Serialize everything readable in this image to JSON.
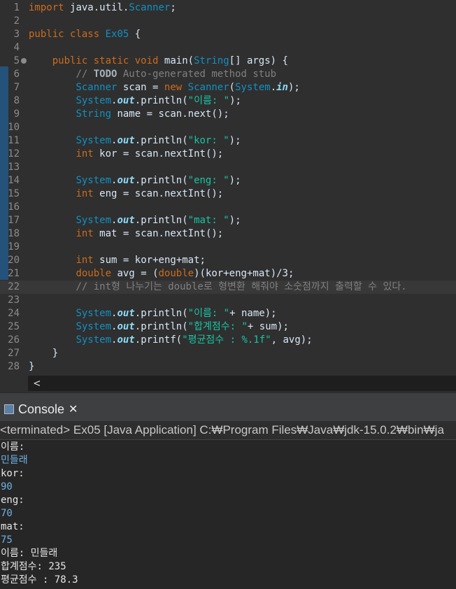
{
  "editor": {
    "lines": [
      {
        "n": "1",
        "code": "import java.util.Scanner;"
      },
      {
        "n": "2",
        "code": ""
      },
      {
        "n": "3",
        "code": "public class Ex05 {"
      },
      {
        "n": "4",
        "code": ""
      },
      {
        "n": "5",
        "code": "    public static void main(String[] args) {"
      },
      {
        "n": "6",
        "code": "        // TODO Auto-generated method stub"
      },
      {
        "n": "7",
        "code": "        Scanner scan = new Scanner(System.in);"
      },
      {
        "n": "8",
        "code": "        System.out.println(\"이름: \");"
      },
      {
        "n": "9",
        "code": "        String name = scan.next();"
      },
      {
        "n": "10",
        "code": ""
      },
      {
        "n": "11",
        "code": "        System.out.println(\"kor: \");"
      },
      {
        "n": "12",
        "code": "        int kor = scan.nextInt();"
      },
      {
        "n": "13",
        "code": ""
      },
      {
        "n": "14",
        "code": "        System.out.println(\"eng: \");"
      },
      {
        "n": "15",
        "code": "        int eng = scan.nextInt();"
      },
      {
        "n": "16",
        "code": ""
      },
      {
        "n": "17",
        "code": "        System.out.println(\"mat: \");"
      },
      {
        "n": "18",
        "code": "        int mat = scan.nextInt();"
      },
      {
        "n": "19",
        "code": ""
      },
      {
        "n": "20",
        "code": "        int sum = kor+eng+mat;"
      },
      {
        "n": "21",
        "code": "        double avg = (double)(kor+eng+mat)/3;"
      },
      {
        "n": "22",
        "code": "        // int형 나누기는 double로 형변환 해줘야 소숫점까지 출력할 수 있다."
      },
      {
        "n": "23",
        "code": ""
      },
      {
        "n": "24",
        "code": "        System.out.println(\"이름: \"+ name);"
      },
      {
        "n": "25",
        "code": "        System.out.println(\"합계점수: \"+ sum);"
      },
      {
        "n": "26",
        "code": "        System.out.printf(\"평균점수 : %.1f\", avg);"
      },
      {
        "n": "27",
        "code": "    }"
      },
      {
        "n": "28",
        "code": "}"
      }
    ],
    "scroll_left_glyph": "<"
  },
  "console": {
    "tab_label": "Console",
    "close_glyph": "✕",
    "header": "<terminated> Ex05 [Java Application] C:₩Program Files₩Java₩jdk-15.0.2₩bin₩ja",
    "output": [
      {
        "text": "이름:",
        "kind": "sys"
      },
      {
        "text": "민들래",
        "kind": "in"
      },
      {
        "text": "kor:",
        "kind": "sys"
      },
      {
        "text": "90",
        "kind": "in"
      },
      {
        "text": "eng:",
        "kind": "sys"
      },
      {
        "text": "70",
        "kind": "in"
      },
      {
        "text": "mat:",
        "kind": "sys"
      },
      {
        "text": "75",
        "kind": "in"
      },
      {
        "text": "이름: 민들래",
        "kind": "sys"
      },
      {
        "text": "합계점수: 235",
        "kind": "sys"
      },
      {
        "text": "평균점수 : 78.3",
        "kind": "sys"
      }
    ]
  }
}
